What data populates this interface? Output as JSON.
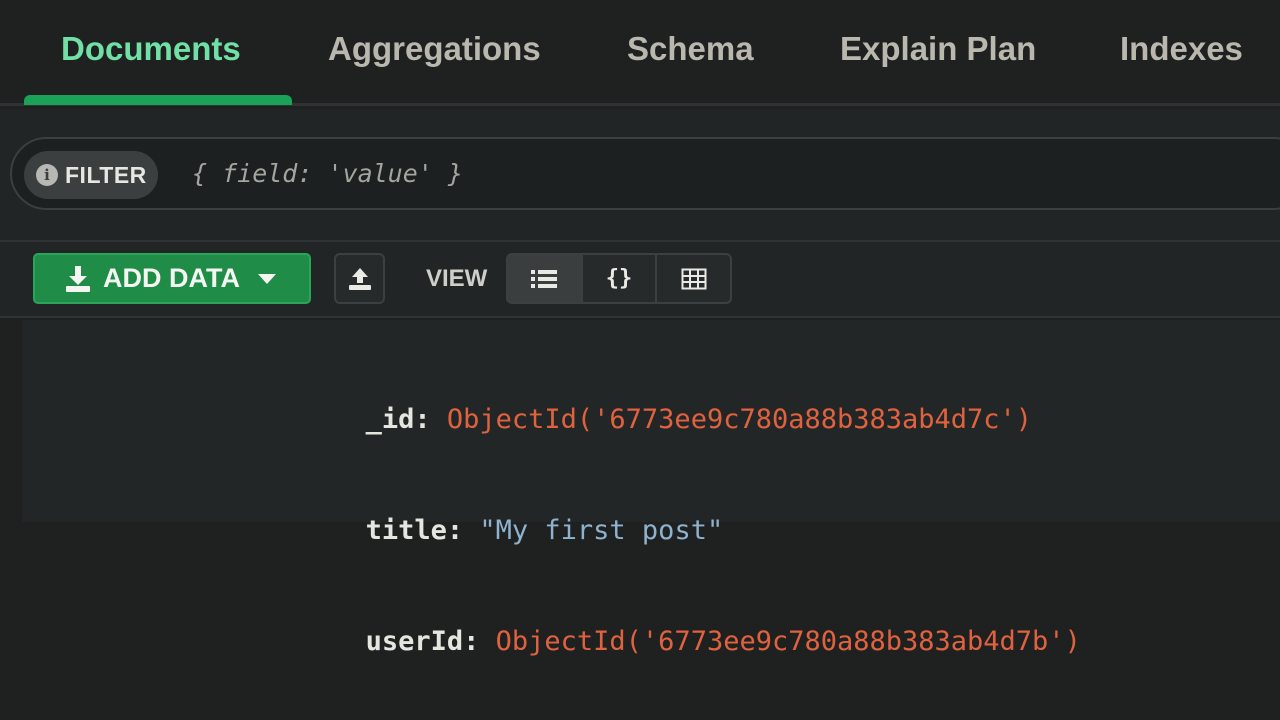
{
  "tabs": [
    {
      "label": "Documents",
      "active": true
    },
    {
      "label": "Aggregations",
      "active": false
    },
    {
      "label": "Schema",
      "active": false
    },
    {
      "label": "Explain Plan",
      "active": false
    },
    {
      "label": "Indexes",
      "active": false
    }
  ],
  "filter": {
    "label": "FILTER",
    "info_icon": "i",
    "placeholder": "{ field: 'value' }"
  },
  "toolbar": {
    "add_data_label": "ADD DATA",
    "view_label": "VIEW",
    "view_modes": [
      {
        "mode": "list",
        "icon": "list-icon",
        "selected": true
      },
      {
        "mode": "json",
        "icon": "braces-icon",
        "label": "{}",
        "selected": false
      },
      {
        "mode": "table",
        "icon": "table-icon",
        "selected": false
      }
    ]
  },
  "document": {
    "fields": [
      {
        "key": "_id:",
        "value": "ObjectId('6773ee9c780a88b383ab4d7c')",
        "type": "objectid"
      },
      {
        "key": "title:",
        "value": "\"My first post\"",
        "type": "string"
      },
      {
        "key": "userId:",
        "value": "ObjectId('6773ee9c780a88b383ab4d7b')",
        "type": "objectid"
      }
    ]
  },
  "colors": {
    "active_tab": "#71e0a6",
    "accent_green": "#1f8d47",
    "objectid": "#e0623f",
    "string": "#8fb2cf"
  }
}
